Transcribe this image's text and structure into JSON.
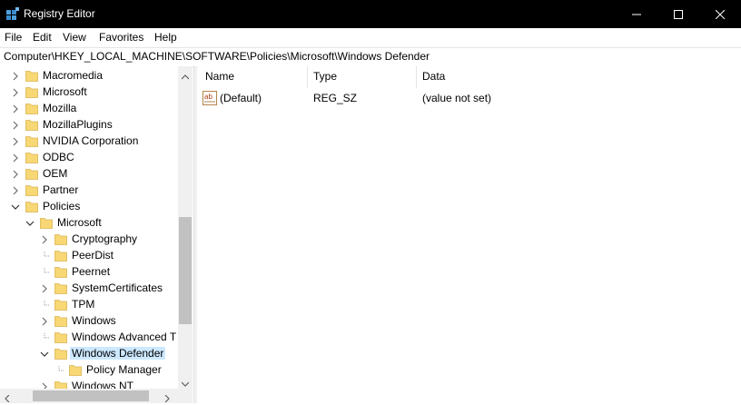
{
  "window": {
    "title": "Registry Editor",
    "icon": "registry-icon",
    "controls": [
      "minimize-icon",
      "maximize-icon",
      "close-icon"
    ]
  },
  "menu": {
    "file": "File",
    "edit": "Edit",
    "view": "View",
    "favorites": "Favorites",
    "help": "Help"
  },
  "address": {
    "path": "Computer\\HKEY_LOCAL_MACHINE\\SOFTWARE\\Policies\\Microsoft\\Windows Defender"
  },
  "tree": {
    "items": [
      {
        "label": "Macromedia",
        "level": 1,
        "expander": "collapsed"
      },
      {
        "label": "Microsoft",
        "level": 1,
        "expander": "collapsed"
      },
      {
        "label": "Mozilla",
        "level": 1,
        "expander": "collapsed"
      },
      {
        "label": "MozillaPlugins",
        "level": 1,
        "expander": "collapsed"
      },
      {
        "label": "NVIDIA Corporation",
        "level": 1,
        "expander": "collapsed"
      },
      {
        "label": "ODBC",
        "level": 1,
        "expander": "collapsed"
      },
      {
        "label": "OEM",
        "level": 1,
        "expander": "collapsed"
      },
      {
        "label": "Partner",
        "level": 1,
        "expander": "collapsed"
      },
      {
        "label": "Policies",
        "level": 1,
        "expander": "expanded"
      },
      {
        "label": "Microsoft",
        "level": 2,
        "expander": "expanded"
      },
      {
        "label": "Cryptography",
        "level": 3,
        "expander": "collapsed"
      },
      {
        "label": "PeerDist",
        "level": 3,
        "expander": "none"
      },
      {
        "label": "Peernet",
        "level": 3,
        "expander": "none"
      },
      {
        "label": "SystemCertificates",
        "level": 3,
        "expander": "collapsed"
      },
      {
        "label": "TPM",
        "level": 3,
        "expander": "none"
      },
      {
        "label": "Windows",
        "level": 3,
        "expander": "collapsed"
      },
      {
        "label": "Windows Advanced T",
        "level": 3,
        "expander": "none"
      },
      {
        "label": "Windows Defender",
        "level": 3,
        "expander": "expanded",
        "selected": true
      },
      {
        "label": "Policy Manager",
        "level": 4,
        "expander": "none"
      },
      {
        "label": "Windows NT",
        "level": 3,
        "expander": "collapsed"
      }
    ]
  },
  "list": {
    "headers": {
      "name": "Name",
      "type": "Type",
      "data": "Data"
    },
    "rows": [
      {
        "name": "(Default)",
        "type": "REG_SZ",
        "data": "(value not set)",
        "icon": "string-value-icon"
      }
    ]
  },
  "colors": {
    "titlebar": "#000000",
    "selection": "#cce8ff",
    "folder": "#f8d775"
  }
}
